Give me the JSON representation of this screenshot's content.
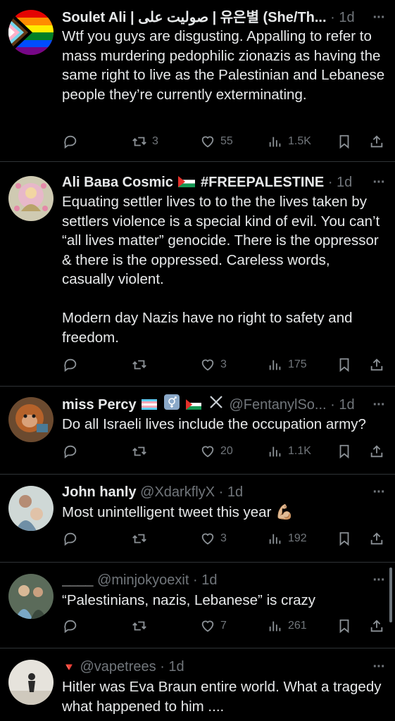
{
  "tweets": [
    {
      "name": "Soulet Ali | صوليت علی | 유은별 (She/Th...",
      "handle": "",
      "time": "1d",
      "text": "Wtf you guys are disgusting. Appalling to refer to mass murdering pedophilic zionazis as having the same right to live as the Palestinian and Lebanese people they’re currently exterminating.",
      "retweets": "3",
      "likes": "55",
      "views": "1.5K"
    },
    {
      "name": "Ali Ваʙа Cosmic",
      "name_suffix": "#FREEPALESTINE",
      "handle": "",
      "time": "1d",
      "text": "Equating settler lives to to the the lives taken by settlers violence is a special kind of evil. You can’t “all lives matter” genocide. There is the oppressor & there is the oppressed. Careless words, casually violent.\n\nModern day Nazis have no right to safety and freedom.",
      "retweets": "",
      "likes": "3",
      "views": "175"
    },
    {
      "name": "miss Percy",
      "handle": "@FentanylSo...",
      "time": "1d",
      "text": "Do all Israeli lives include the occupation army?",
      "retweets": "",
      "likes": "20",
      "views": "1.1K"
    },
    {
      "name": "John hanly",
      "handle": "@XdarkflyX",
      "time": "1d",
      "text": "Most unintelligent tweet this year 💪🏼",
      "retweets": "",
      "likes": "3",
      "views": "192"
    },
    {
      "name": "____",
      "handle": "@minjokyoexit",
      "time": "1d",
      "text": "“Palestinians, nazis, Lebanese” is crazy",
      "retweets": "",
      "likes": "7",
      "views": "261"
    },
    {
      "name": "🔻",
      "handle": "@vapetrees",
      "time": "1d",
      "text": "Hitler was Eva Braun entire world. What a tragedy what happened to him ....",
      "retweets": "",
      "likes": "",
      "views": ""
    }
  ],
  "ui": {
    "separator": "·",
    "more_glyph": "···"
  },
  "colors": {
    "background": "#000000",
    "text": "#e7e9ea",
    "secondary": "#71767b",
    "divider": "#2f3336"
  }
}
